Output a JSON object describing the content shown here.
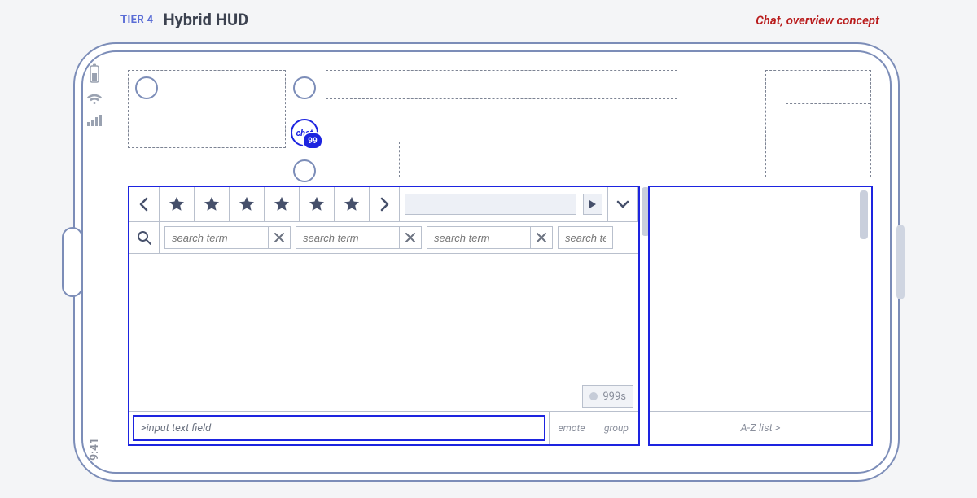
{
  "header": {
    "tier": "TIER 4",
    "title": "Hybrid HUD",
    "subtitle": "Chat, overview concept"
  },
  "status": {
    "time": "9:41"
  },
  "hud": {
    "chat_bubble_label": "chat",
    "chat_badge": "99"
  },
  "chat_panel": {
    "search_placeholder": "search term",
    "typing_indicator": "999s",
    "input_placeholder": ">input text field",
    "emote_btn": "emote",
    "group_btn": "group"
  },
  "side_panel": {
    "footer": "A-Z list >"
  }
}
